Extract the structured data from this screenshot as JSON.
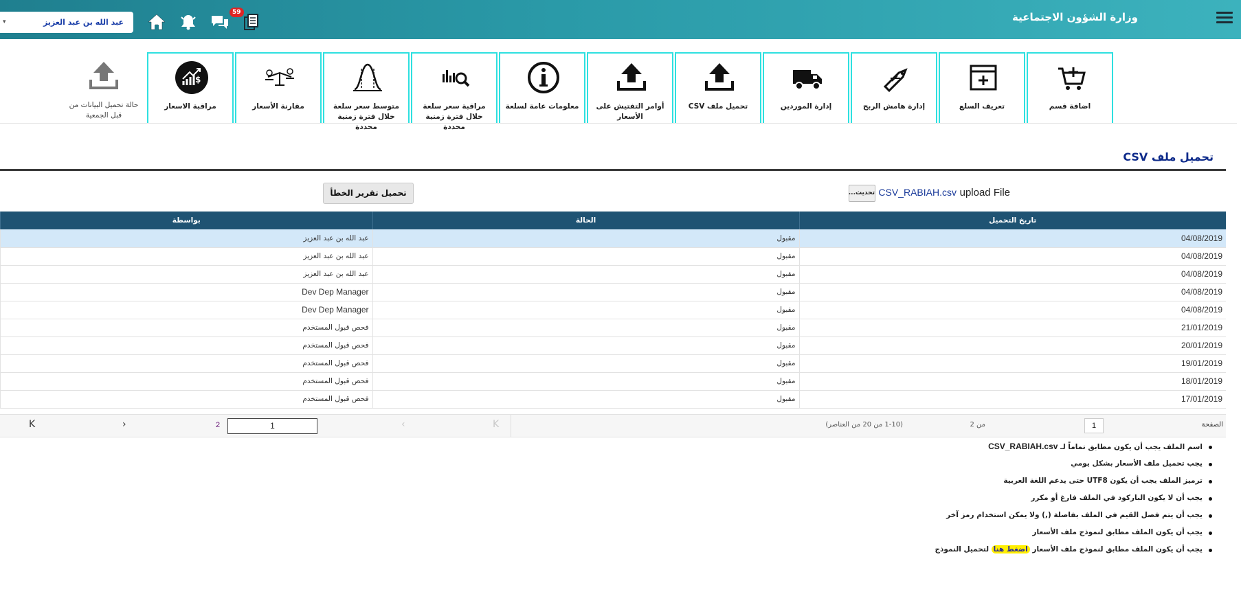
{
  "header": {
    "ministry_name": "وزارة الشؤون الاجتماعية",
    "user_name": "عبد الله بن عبد العزيز",
    "user_caret": "▾",
    "messages_badge": "59"
  },
  "toolbar": {
    "tiles": [
      {
        "label": "اضافة قسم",
        "icon": "add-to-cart-icon"
      },
      {
        "label": "تعريف السلع",
        "icon": "add-window-icon"
      },
      {
        "label": "إدارة هامش الربح",
        "icon": "price-tag-hand-icon"
      },
      {
        "label": "إدارة الموردين",
        "icon": "truck-icon"
      },
      {
        "label": "تحميل ملف CSV",
        "icon": "upload-icon"
      },
      {
        "label": "أوامر التفتيش على الأسعار",
        "icon": "upload-icon"
      },
      {
        "label": "معلومات عامة لسلعة",
        "icon": "info-icon"
      },
      {
        "label": "مراقبة سعر سلعة خلال فترة زمنية محددة",
        "icon": "bar-chart-search-icon"
      },
      {
        "label": "متوسط سعر سلعة خلال فترة زمنية محددة",
        "icon": "bell-curve-icon"
      },
      {
        "label": "مقارنة الأسعار",
        "icon": "balance-scale-icon"
      },
      {
        "label": "مراقبة الاسعار",
        "icon": "dollar-growth-icon"
      },
      {
        "label": "حالة تحميل البيانات من قبل الجمعية",
        "icon": "upload-gray-icon"
      }
    ]
  },
  "section": {
    "title": "تحميل ملف CSV"
  },
  "upload": {
    "label": "upload File",
    "file_name": "CSV_RABIAH.csv",
    "browse_label": "تحديث...",
    "error_report_label": "تحميل تقرير الخطأ"
  },
  "table": {
    "columns": [
      "تاريخ التحميل",
      "الحالة",
      "بواسطة"
    ],
    "rows": [
      {
        "date": "04/08/2019",
        "status": "مقبول",
        "by": "عبد الله بن عبد العزيز"
      },
      {
        "date": "04/08/2019",
        "status": "مقبول",
        "by": "عبد الله بن عبد العزيز"
      },
      {
        "date": "04/08/2019",
        "status": "مقبول",
        "by": "عبد الله بن عبد العزيز"
      },
      {
        "date": "04/08/2019",
        "status": "مقبول",
        "by": "Dev Dep Manager"
      },
      {
        "date": "04/08/2019",
        "status": "مقبول",
        "by": "Dev Dep Manager"
      },
      {
        "date": "21/01/2019",
        "status": "مقبول",
        "by": "فحص قبول المستخدم"
      },
      {
        "date": "20/01/2019",
        "status": "مقبول",
        "by": "فحص قبول المستخدم"
      },
      {
        "date": "19/01/2019",
        "status": "مقبول",
        "by": "فحص قبول المستخدم"
      },
      {
        "date": "18/01/2019",
        "status": "مقبول",
        "by": "فحص قبول المستخدم"
      },
      {
        "date": "17/01/2019",
        "status": "مقبول",
        "by": "فحص قبول المستخدم"
      }
    ]
  },
  "pager": {
    "page_label": "الصفحة",
    "page_value": "1",
    "of_label": "من 2",
    "range_label": "(1-10 من 20 من العناصر)",
    "current_page": "1",
    "next_page": "2",
    "first_glyph": "K",
    "prev_glyph": "‹",
    "next_glyph": "›",
    "last_glyph": "K"
  },
  "notes": [
    {
      "text": "اسم الملف يجب أن يكون مطابق تماماً لـ",
      "suffix": "CSV_RABIAH.csv"
    },
    {
      "text": "يجب تحميل ملف الأسعار بشكل يومي"
    },
    {
      "text": "ترميز الملف يجب أن يكون UTF8 حتى يدعم اللغة العربية"
    },
    {
      "text": "يجب أن لا يكون الباركود في الملف فارغ أو مكرر"
    },
    {
      "text": "يجب أن يتم فصل القيم في الملف بفاصلة (,) ولا يمكن استخدام رمز آخر"
    },
    {
      "text": "يجب أن يكون الملف مطابق لنموذج ملف الأسعار"
    },
    {
      "text": "يجب أن يكون الملف مطابق لنموذج ملف الأسعار",
      "link": "اضغط هنا",
      "after": "لتحميل النموذج"
    }
  ],
  "colors": {
    "header_gradient_start": "#1f7f8f",
    "header_gradient_end": "#3cb2bd",
    "table_header": "#1f5373",
    "selected_row": "#d3e8f9",
    "tile_border": "#2ee0e0",
    "title_color": "#0d2a8a",
    "highlight": "#ffee00"
  }
}
